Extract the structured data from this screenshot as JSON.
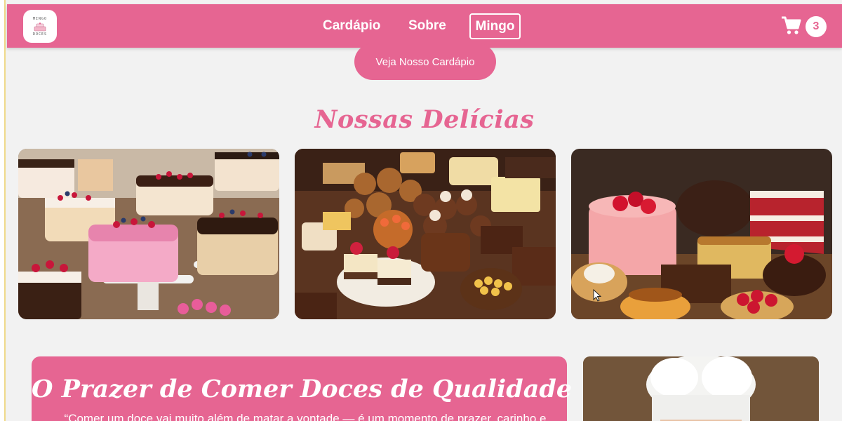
{
  "header": {
    "logo_text_top": "MINGO",
    "logo_text_bottom": "DOCES",
    "nav": {
      "cardapio": "Cardápio",
      "sobre": "Sobre",
      "mingo": "Mingo"
    },
    "cart_icon": "shopping-cart-icon",
    "cart_count": "3"
  },
  "hero": {
    "cta_label": "Veja Nosso Cardápio"
  },
  "gallery": {
    "title": "Nossas Delícias"
  },
  "quality": {
    "title": "O Prazer de Comer Doces de Qualidade",
    "quote": "“Comer um doce vai muito além de matar a vontade — é um momento de prazer, carinho e"
  },
  "colors": {
    "brand_pink": "#e66592",
    "background": "#f2f2f2"
  }
}
